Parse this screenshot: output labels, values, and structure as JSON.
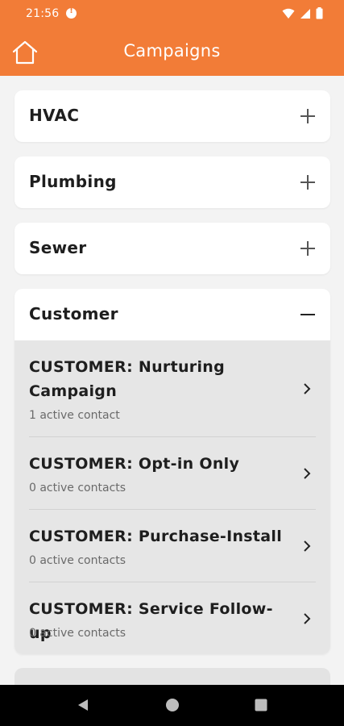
{
  "status_bar": {
    "time": "21:56"
  },
  "app_bar": {
    "title": "Campaigns"
  },
  "categories": [
    {
      "label": "HVAC",
      "expanded": false
    },
    {
      "label": "Plumbing",
      "expanded": false
    },
    {
      "label": "Sewer",
      "expanded": false
    },
    {
      "label": "Customer",
      "expanded": true
    }
  ],
  "customer_campaigns": [
    {
      "name_line1": "CUSTOMER: Nurturing",
      "name_line2": "Campaign",
      "contacts": "1 active contact"
    },
    {
      "name_line1": "CUSTOMER: Opt-in Only",
      "name_line2": "",
      "contacts": "0 active contacts"
    },
    {
      "name_line1": "CUSTOMER: Purchase-Install",
      "name_line2": "",
      "contacts": "0 active contacts"
    },
    {
      "name_line1": "CUSTOMER: Service Follow-up",
      "name_line2": "",
      "contacts": "0 active contacts"
    }
  ],
  "colors": {
    "accent": "#f27c37",
    "card": "#ffffff",
    "sublist": "#e6e6e6",
    "background": "#f3f3f3"
  },
  "icons": [
    "info-icon",
    "wifi-icon",
    "signal-icon",
    "battery-icon",
    "home-icon",
    "plus-icon",
    "minus-icon",
    "chevron-right-icon",
    "back-icon",
    "home-circle-icon",
    "recents-icon"
  ]
}
